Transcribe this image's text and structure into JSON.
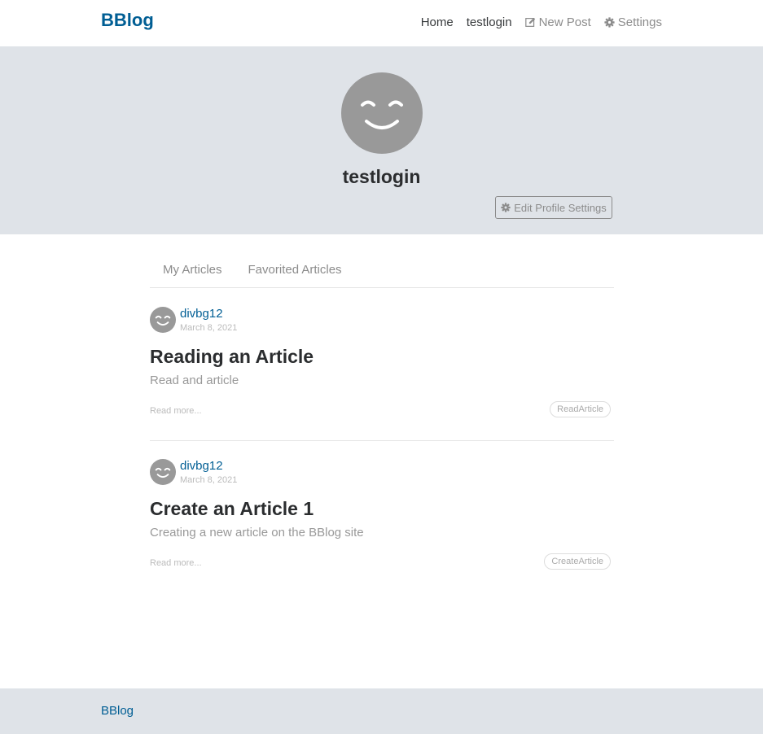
{
  "navbar": {
    "brand": "BBlog",
    "items": [
      {
        "label": "Home",
        "icon": ""
      },
      {
        "label": "testlogin",
        "icon": ""
      },
      {
        "label": "New Post",
        "icon": "edit-icon"
      },
      {
        "label": "Settings",
        "icon": "gear-icon"
      }
    ]
  },
  "profile": {
    "username": "testlogin",
    "avatar_icon": "smiley-avatar-icon",
    "edit_button_label": "Edit Profile Settings"
  },
  "tabs": [
    {
      "label": "My Articles"
    },
    {
      "label": "Favorited Articles"
    }
  ],
  "articles": [
    {
      "author": "divbg12",
      "date": "March 8, 2021",
      "title": "Reading an Article",
      "description": "Read and article",
      "read_more": "Read more...",
      "tag": "ReadArticle"
    },
    {
      "author": "divbg12",
      "date": "March 8, 2021",
      "title": "Create an Article 1",
      "description": "Creating a new article on the BBlog site",
      "read_more": "Read more...",
      "tag": "CreateArticle"
    }
  ],
  "footer": {
    "brand": "BBlog"
  },
  "colors": {
    "brand": "#005e94",
    "banner_bg": "#dfe3e8",
    "avatar": "#999999"
  }
}
